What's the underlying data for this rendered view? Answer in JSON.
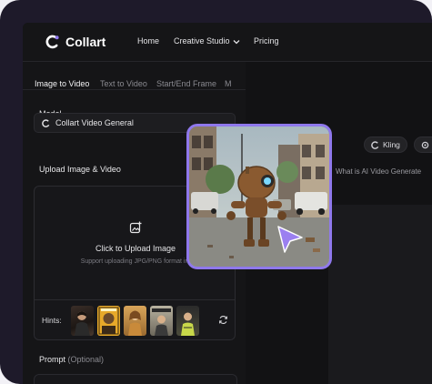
{
  "app": {
    "brand": "Collart"
  },
  "nav": {
    "home": "Home",
    "creative_studio": "Creative Studio",
    "pricing": "Pricing"
  },
  "tabs": [
    {
      "label": "Image to Video",
      "active": true
    },
    {
      "label": "Text to Video",
      "active": false
    },
    {
      "label": "Start/End Frame",
      "active": false
    },
    {
      "label": "M",
      "active": false
    }
  ],
  "model": {
    "section_label": "Model",
    "selected": "Collart Video General"
  },
  "upload": {
    "section_label": "Upload Image & Video",
    "title": "Click to Upload Image",
    "subtitle": "Support uploading JPG/PNG format im",
    "hints_label": "Hints:"
  },
  "prompt": {
    "label": "Prompt",
    "optional": "(Optional)"
  },
  "right": {
    "pill_1": "Kling",
    "pill_2": "",
    "text": "What is AI Video Generate"
  },
  "colors": {
    "accent": "#8f78ec",
    "background": "#131315",
    "frame": "#1e1a2a"
  }
}
